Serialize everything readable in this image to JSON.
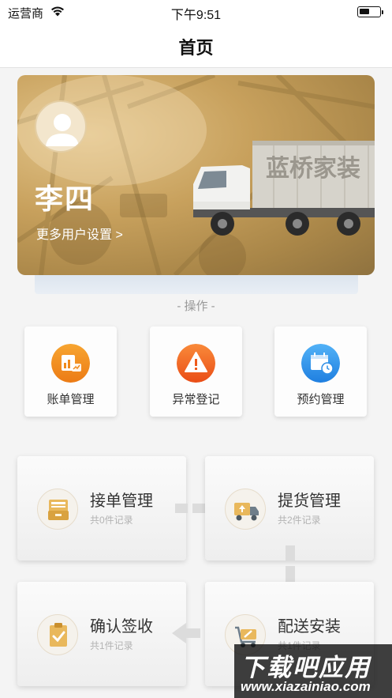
{
  "status_bar": {
    "carrier": "运营商",
    "time": "下午9:51"
  },
  "nav": {
    "title": "首页"
  },
  "banner": {
    "user_name": "李四",
    "settings_link": "更多用户设置 >",
    "truck_text": "蓝桥家装"
  },
  "operations": {
    "section_label": "- 操作 -",
    "items": [
      {
        "label": "账单管理",
        "icon": "bill-chart-icon",
        "color": "#f08a1c"
      },
      {
        "label": "异常登记",
        "icon": "warning-icon",
        "color": "#f0601e"
      },
      {
        "label": "预约管理",
        "icon": "calendar-clock-icon",
        "color": "#2e8ee6"
      }
    ]
  },
  "workflow": [
    {
      "title": "接单管理",
      "subtitle": "共0件记录",
      "icon": "order-box-icon"
    },
    {
      "title": "提货管理",
      "subtitle": "共2件记录",
      "icon": "truck-upload-icon"
    },
    {
      "title": "确认签收",
      "subtitle": "共1件记录",
      "icon": "clipboard-check-icon"
    },
    {
      "title": "配送安装",
      "subtitle": "共1件记录",
      "icon": "tools-cart-icon"
    }
  ],
  "watermark": {
    "main": "下载吧应用",
    "url": "www.xiazainiao.com"
  }
}
